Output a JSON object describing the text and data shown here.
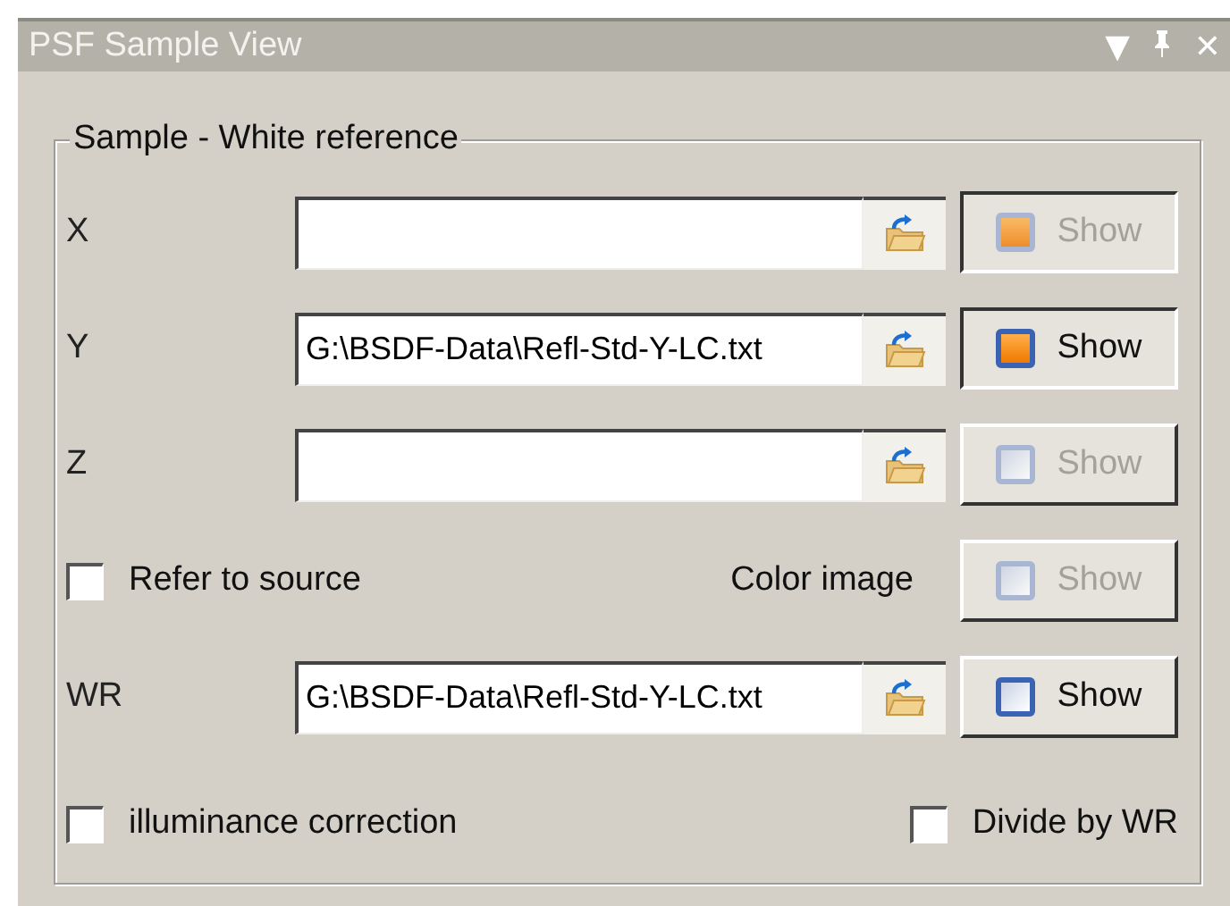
{
  "window": {
    "title": "PSF Sample View",
    "controls": [
      "▼",
      "✕"
    ]
  },
  "group": {
    "title": "Sample - White reference",
    "rows": [
      {
        "kind": "file",
        "label": "X",
        "value": "",
        "show": {
          "label": "Show",
          "checked": true,
          "disabled": true
        }
      },
      {
        "kind": "file",
        "label": "Y",
        "value": "G:\\BSDF-Data\\Refl-Std-Y-LC.txt",
        "show": {
          "label": "Show",
          "checked": true,
          "disabled": false
        }
      },
      {
        "kind": "file",
        "label": "Z",
        "value": "",
        "show": {
          "label": "Show",
          "checked": false,
          "disabled": true
        }
      },
      {
        "kind": "option",
        "checkbox": {
          "label": "Refer to source",
          "checked": false
        },
        "label": "Color image",
        "show": {
          "label": "Show",
          "checked": false,
          "disabled": true
        }
      },
      {
        "kind": "file",
        "label": "WR",
        "value": "G:\\BSDF-Data\\Refl-Std-Y-LC.txt",
        "show": {
          "label": "Show",
          "checked": false,
          "disabled": false
        }
      },
      {
        "kind": "checks",
        "left": {
          "label": "illuminance correction",
          "checked": false
        },
        "right": {
          "label": "Divide by WR",
          "checked": false
        }
      }
    ]
  }
}
